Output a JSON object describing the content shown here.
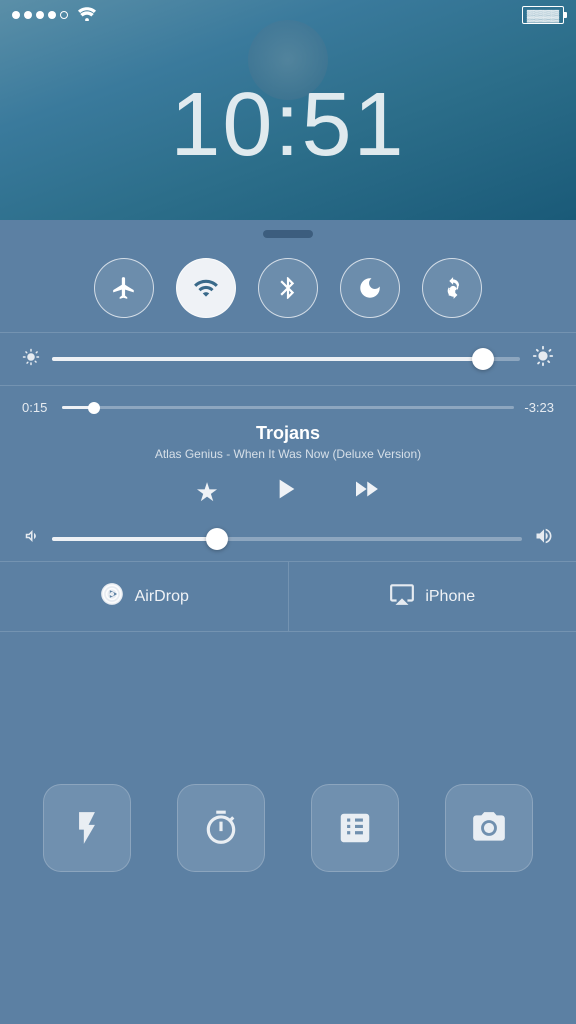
{
  "lockscreen": {
    "time": "10:51",
    "signal_dots": [
      "filled",
      "filled",
      "filled",
      "filled",
      "empty"
    ],
    "battery_label": "Battery"
  },
  "controlcenter": {
    "toggles": [
      {
        "id": "airplane",
        "label": "Airplane Mode",
        "active": false
      },
      {
        "id": "wifi",
        "label": "Wi-Fi",
        "active": true
      },
      {
        "id": "bluetooth",
        "label": "Bluetooth",
        "active": false
      },
      {
        "id": "donotdisturb",
        "label": "Do Not Disturb",
        "active": false
      },
      {
        "id": "rotation",
        "label": "Rotation Lock",
        "active": false
      }
    ],
    "brightness": {
      "value_pct": 92
    },
    "music": {
      "elapsed": "0:15",
      "remaining": "-3:23",
      "progress_pct": 7,
      "title": "Trojans",
      "subtitle": "Atlas Genius - When It Was Now (Deluxe Version)",
      "volume_pct": 35
    },
    "share": [
      {
        "id": "airdrop",
        "label": "AirDrop"
      },
      {
        "id": "iphone",
        "label": "iPhone"
      }
    ],
    "quick_actions": [
      {
        "id": "flashlight",
        "label": "Flashlight"
      },
      {
        "id": "timer",
        "label": "Timer"
      },
      {
        "id": "calculator",
        "label": "Calculator"
      },
      {
        "id": "camera",
        "label": "Camera"
      }
    ]
  }
}
